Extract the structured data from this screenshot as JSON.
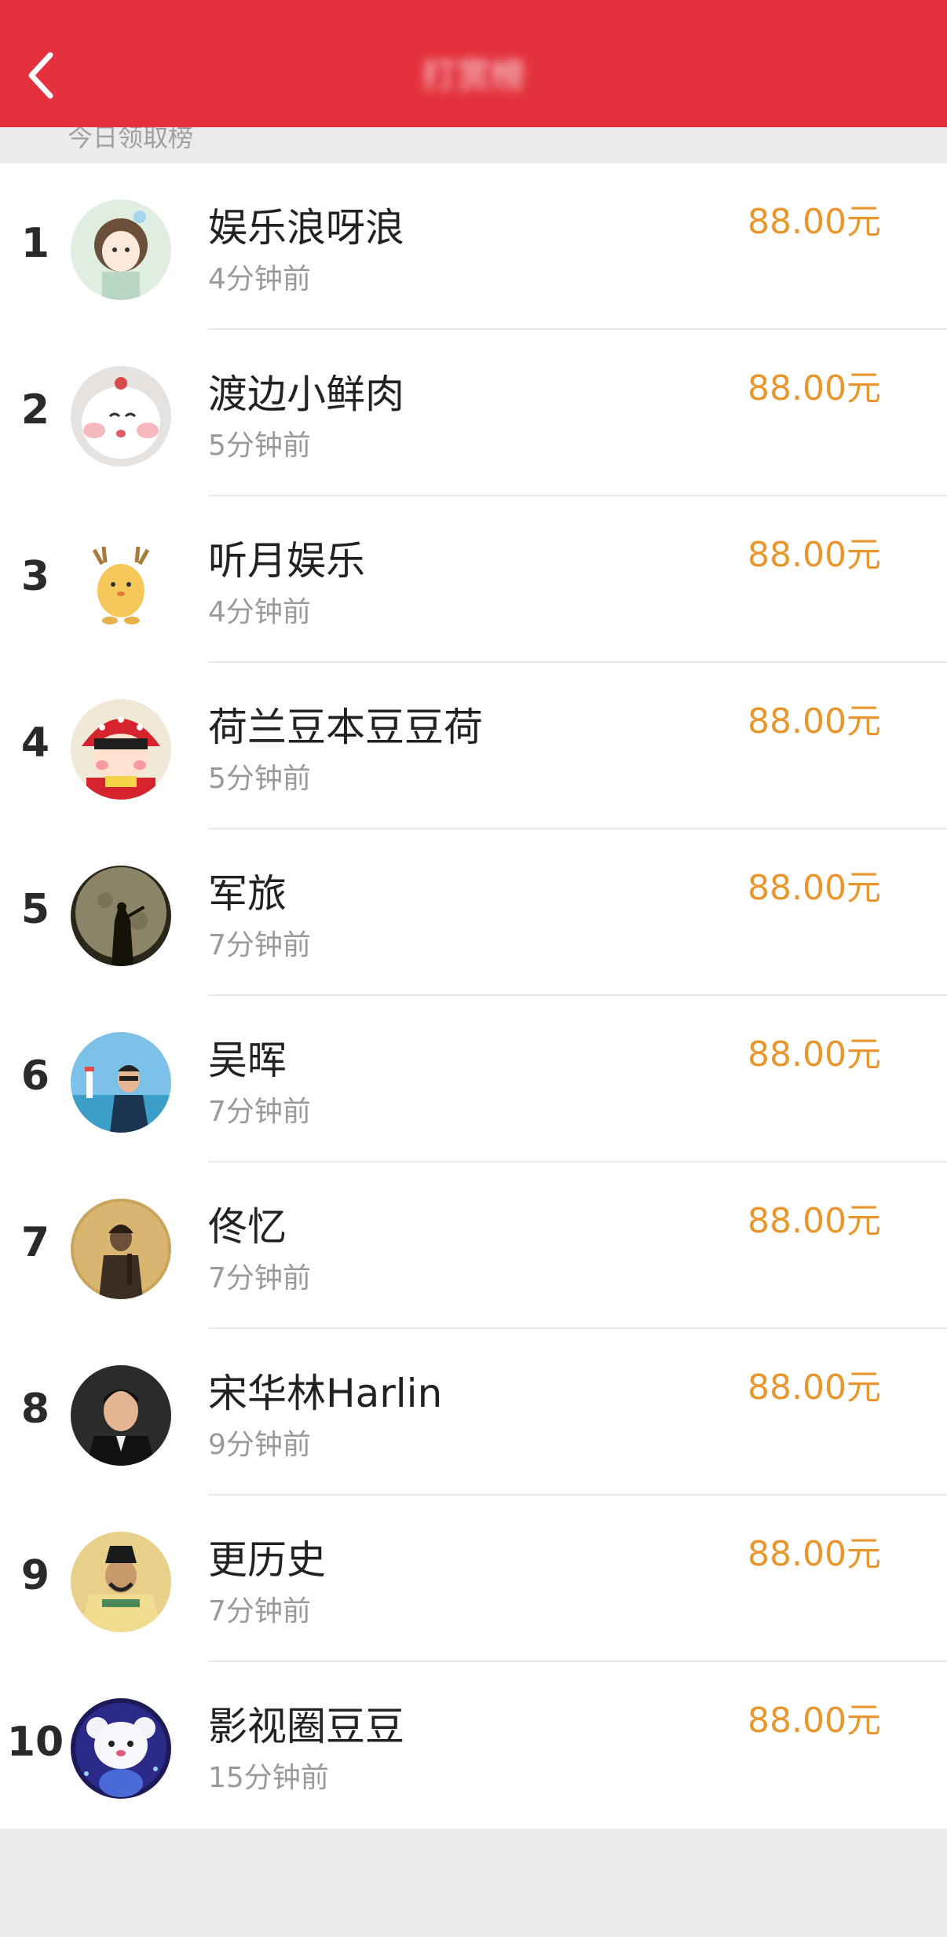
{
  "header": {
    "title": "打赏榜",
    "background_color": "#e3313d",
    "back_icon": "chevron-left-icon"
  },
  "subbar": {
    "text": "今日领取榜"
  },
  "accent_color": "#e8962e",
  "items": [
    {
      "rank": "1",
      "name": "娱乐浪呀浪",
      "time": "4分钟前",
      "amount": "88.00元"
    },
    {
      "rank": "2",
      "name": "渡边小鲜肉",
      "time": "5分钟前",
      "amount": "88.00元"
    },
    {
      "rank": "3",
      "name": "听月娱乐",
      "time": "4分钟前",
      "amount": "88.00元"
    },
    {
      "rank": "4",
      "name": "荷兰豆本豆豆荷",
      "time": "5分钟前",
      "amount": "88.00元"
    },
    {
      "rank": "5",
      "name": "军旅",
      "time": "7分钟前",
      "amount": "88.00元"
    },
    {
      "rank": "6",
      "name": "吴晖",
      "time": "7分钟前",
      "amount": "88.00元"
    },
    {
      "rank": "7",
      "name": "佟忆",
      "time": "7分钟前",
      "amount": "88.00元"
    },
    {
      "rank": "8",
      "name": "宋华林Harlin",
      "time": "9分钟前",
      "amount": "88.00元"
    },
    {
      "rank": "9",
      "name": "更历史",
      "time": "7分钟前",
      "amount": "88.00元"
    },
    {
      "rank": "10",
      "name": "影视圈豆豆",
      "time": "15分钟前",
      "amount": "88.00元"
    }
  ]
}
